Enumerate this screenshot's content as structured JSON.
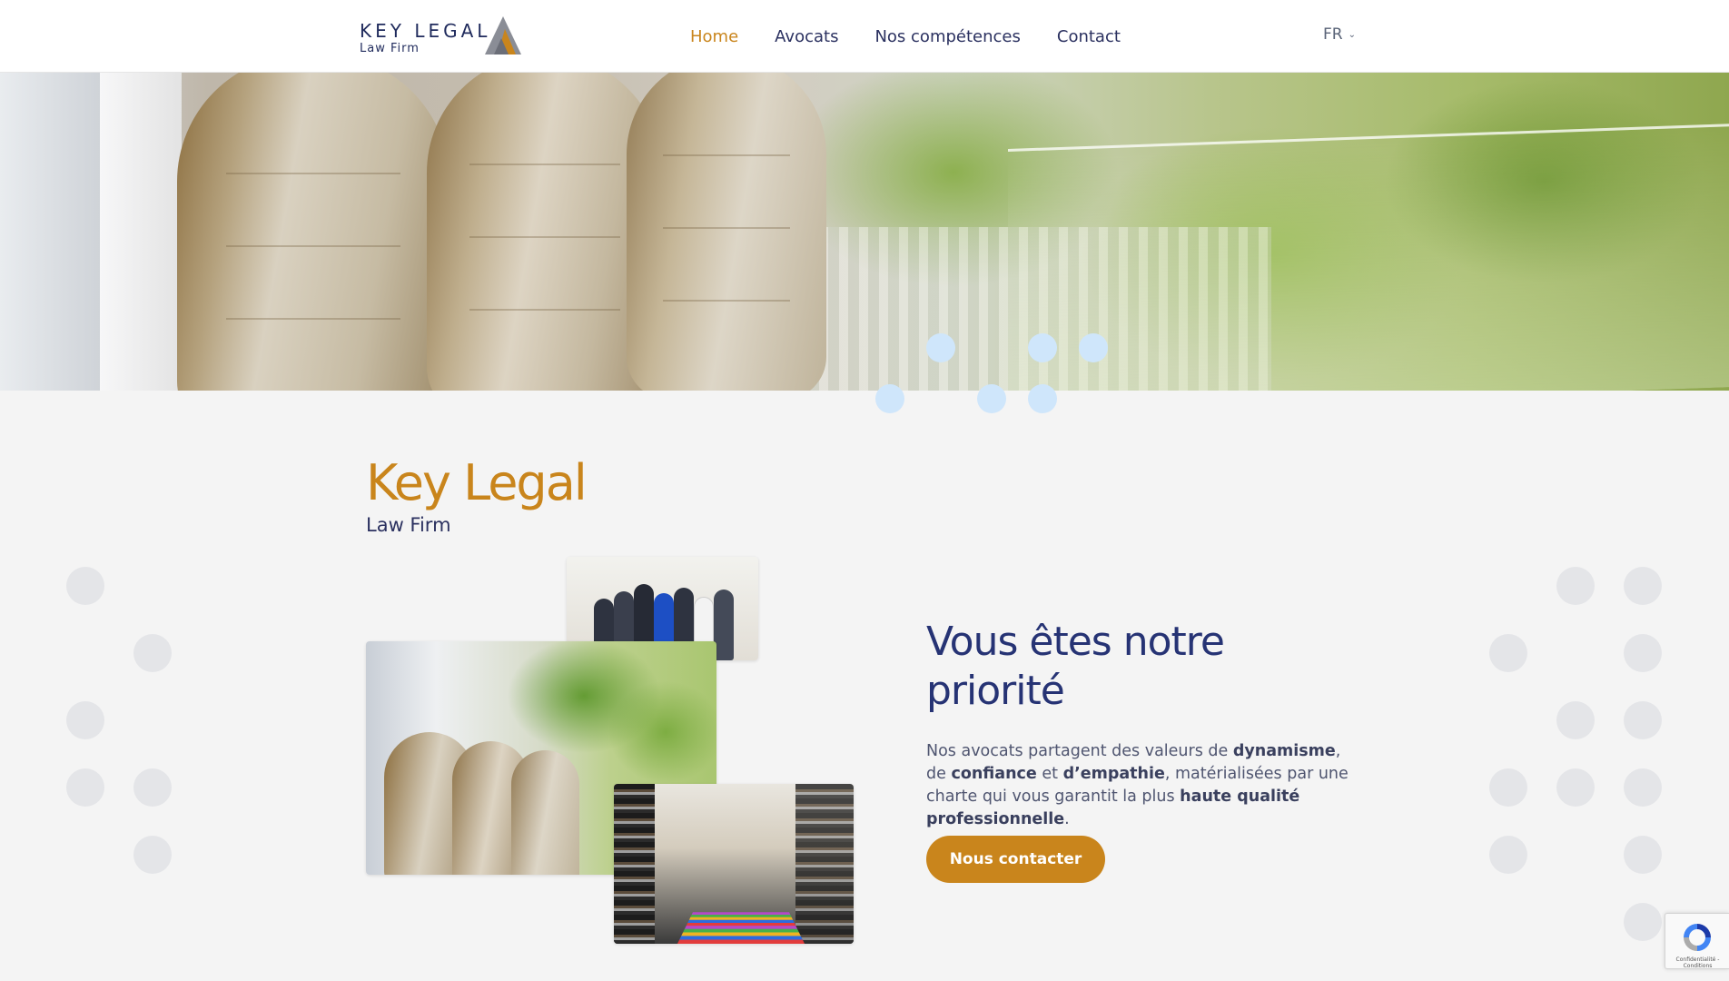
{
  "header": {
    "logo_name": "KEY LEGAL",
    "logo_sub": "Law Firm",
    "nav": [
      {
        "label": "Home",
        "active": true
      },
      {
        "label": "Avocats",
        "active": false
      },
      {
        "label": "Nos compétences",
        "active": false
      },
      {
        "label": "Contact",
        "active": false
      }
    ],
    "language": "FR",
    "language_icon": "chevron-down-icon"
  },
  "intro": {
    "title": "Key Legal",
    "subtitle": "Law Firm"
  },
  "priority": {
    "title": "Vous êtes notre priorité",
    "text_parts": [
      {
        "t": "Nos avocats partagent des valeurs de ",
        "bold": false
      },
      {
        "t": "dynamisme",
        "bold": true
      },
      {
        "t": ", de ",
        "bold": false
      },
      {
        "t": "confiance",
        "bold": true
      },
      {
        "t": " et ",
        "bold": false
      },
      {
        "t": "d’empathie",
        "bold": true
      },
      {
        "t": ", matérialisées par une charte qui vous garantit la plus ",
        "bold": false
      },
      {
        "t": "haute qualité professionnelle",
        "bold": true
      },
      {
        "t": ".",
        "bold": false
      }
    ],
    "cta_label": "Nous contacter"
  },
  "recaptcha": {
    "label": "Confidentialité - Conditions"
  },
  "colors": {
    "accent": "#c9851c",
    "navy": "#263374",
    "dot_light_blue": "#cfe6fb",
    "dot_grey": "#e4e5e8",
    "background": "#f4f4f4"
  }
}
